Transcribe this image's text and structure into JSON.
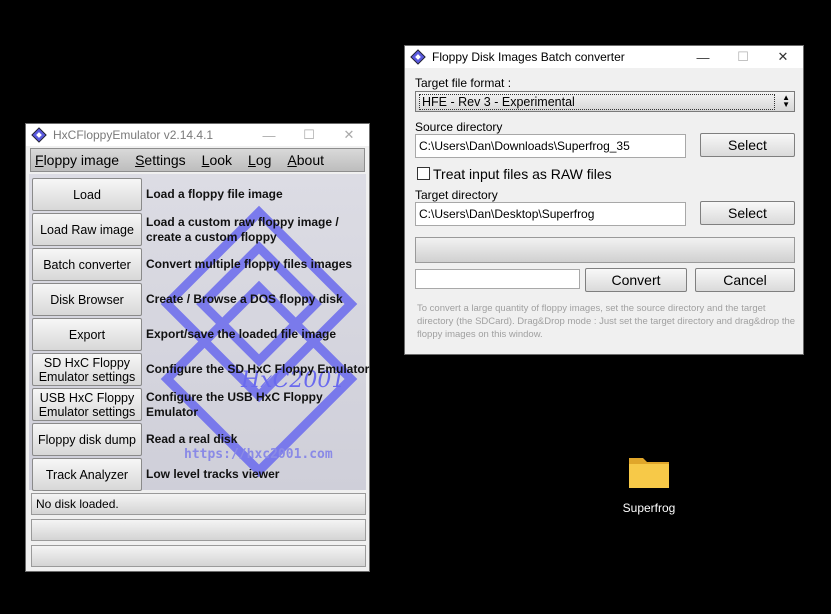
{
  "hxc": {
    "title": "HxCFloppyEmulator v2.14.4.1",
    "menu": [
      "Floppy image",
      "Settings",
      "Look",
      "Log",
      "About"
    ],
    "buttons": [
      {
        "label": "Load",
        "desc": "Load a floppy file image"
      },
      {
        "label": "Load Raw image",
        "desc": "Load a custom raw floppy image / create a custom floppy"
      },
      {
        "label": "Batch converter",
        "desc": "Convert multiple floppy files images"
      },
      {
        "label": "Disk Browser",
        "desc": "Create / Browse a DOS floppy disk"
      },
      {
        "label": "Export",
        "desc": "Export/save the loaded file image"
      },
      {
        "label": "SD HxC Floppy Emulator settings",
        "desc": "Configure the SD HxC Floppy Emulator"
      },
      {
        "label": "USB HxC Floppy Emulator settings",
        "desc": "Configure the USB HxC Floppy Emulator"
      },
      {
        "label": "Floppy disk dump",
        "desc": "Read a real disk"
      },
      {
        "label": "Track Analyzer",
        "desc": "Low level tracks viewer"
      }
    ],
    "logo_text": "HxC2001",
    "url": "https://hxc2001.com",
    "status": "No disk loaded."
  },
  "batch": {
    "title": "Floppy Disk Images Batch converter",
    "target_format_label": "Target file format :",
    "target_format_value": "HFE - Rev 3 - Experimental",
    "source_label": "Source directory",
    "source_value": "C:\\Users\\Dan\\Downloads\\Superfrog_35",
    "select_label": "Select",
    "raw_label": "Treat input files as RAW files",
    "target_dir_label": "Target directory",
    "target_dir_value": "C:\\Users\\Dan\\Desktop\\Superfrog",
    "convert_label": "Convert",
    "cancel_label": "Cancel",
    "info": "To convert a large quantity of floppy images, set the source directory and the target directory (the SDCard). Drag&Drop mode : Just set the target directory and drag&drop the floppy images on this window."
  },
  "desktop": {
    "folder_name": "Superfrog"
  },
  "colors": {
    "desktop_bg": "#000000",
    "logo_blue": "#6666ee",
    "folder_yellow": "#f5c542"
  }
}
